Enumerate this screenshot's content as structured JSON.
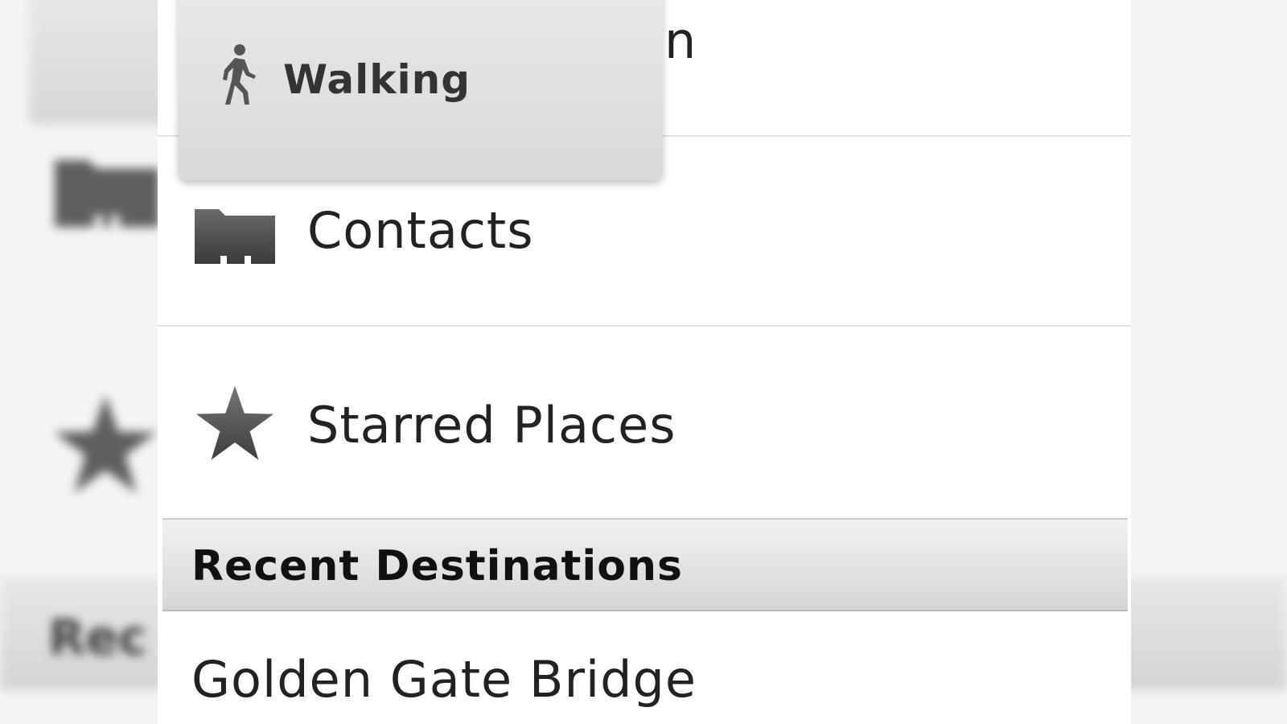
{
  "popup": {
    "selected_option": {
      "label": "Walking",
      "icon": "walking-icon"
    }
  },
  "list": {
    "partial_item_tail": "n",
    "items": [
      {
        "label": "Contacts",
        "icon": "contacts-folder-icon"
      },
      {
        "label": "Starred Places",
        "icon": "star-icon"
      }
    ]
  },
  "recent": {
    "header": "Recent Destinations",
    "items": [
      {
        "label": "Golden Gate Bridge"
      }
    ]
  },
  "background": {
    "header_fragment": "Rec"
  },
  "colors": {
    "icon": "#555555",
    "text": "#222222",
    "header_text": "#111111",
    "divider": "#e2e2e2"
  }
}
